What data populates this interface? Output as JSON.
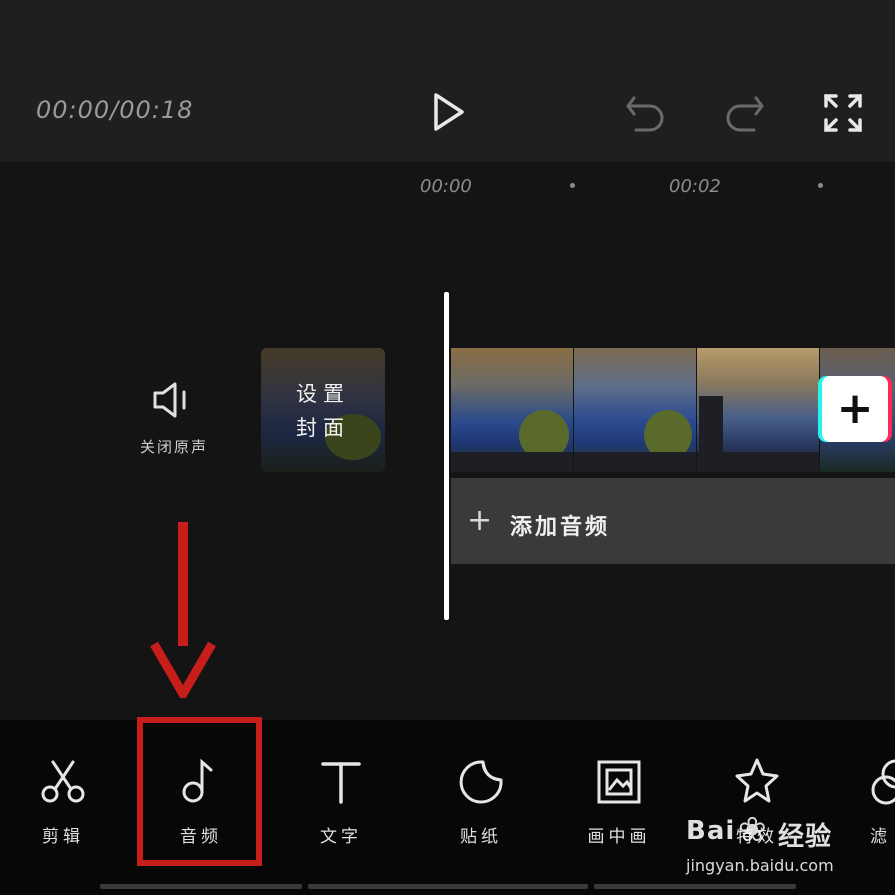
{
  "header": {
    "timecode": "00:00/00:18",
    "icons": [
      "play-icon",
      "undo-icon",
      "redo-icon",
      "fullscreen-icon"
    ]
  },
  "ruler": {
    "times": [
      "00:00",
      "00:02"
    ]
  },
  "track": {
    "mute_label": "关闭原声",
    "cover_line1": "设置",
    "cover_line2": "封面",
    "add_clip": "+",
    "add_audio_plus": "+",
    "add_audio_label": "添加音频"
  },
  "toolbar": {
    "items": [
      {
        "label": "剪辑",
        "icon": "scissors-icon"
      },
      {
        "label": "音频",
        "icon": "music-note-icon"
      },
      {
        "label": "文字",
        "icon": "text-icon"
      },
      {
        "label": "贴纸",
        "icon": "sticker-icon"
      },
      {
        "label": "画中画",
        "icon": "picture-in-picture-icon"
      },
      {
        "label": "特效",
        "icon": "effects-icon"
      },
      {
        "label": "滤",
        "icon": "filter-icon"
      }
    ]
  },
  "watermark": {
    "brand": "Bai",
    "brand2": "经验",
    "url": "jingyan.baidu.com"
  },
  "colors": {
    "annotation": "#c81e1a",
    "toolbar_bg": "#070707",
    "header_bg": "#1f1f1f"
  }
}
